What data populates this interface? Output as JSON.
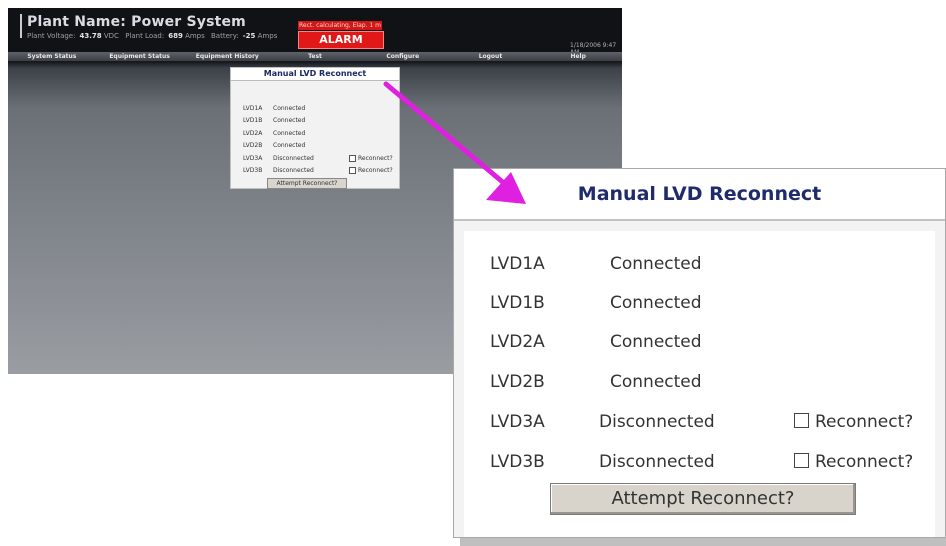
{
  "app": {
    "plant_label": "Plant Name:",
    "plant_name": "Power System",
    "stats": {
      "voltage_label": "Plant Voltage:",
      "voltage_value": "43.78",
      "voltage_unit": "VDC",
      "load_label": "Plant Load:",
      "load_value": "689",
      "load_unit": "Amps",
      "battery_label": "Battery:",
      "battery_value": "-25",
      "battery_unit": "Amps"
    },
    "rect_status": "Rect. calculating, Elap. 1 m",
    "alarm": "ALARM",
    "timestamp": "1/18/2006 9:47 AM",
    "menu": [
      "System Status",
      "Equipment Status",
      "Equipment History",
      "Test",
      "Configure",
      "Logout",
      "Help"
    ]
  },
  "dialog": {
    "title": "Manual LVD Reconnect",
    "rows": [
      {
        "name": "LVD1A",
        "status": "Connected"
      },
      {
        "name": "LVD1B",
        "status": "Connected"
      },
      {
        "name": "LVD2A",
        "status": "Connected"
      },
      {
        "name": "LVD2B",
        "status": "Connected"
      },
      {
        "name": "LVD3A",
        "status": "Disconnected",
        "checkbox_label": "Reconnect?"
      },
      {
        "name": "LVD3B",
        "status": "Disconnected",
        "checkbox_label": "Reconnect?"
      }
    ],
    "button_label": "Attempt Reconnect?"
  },
  "colors": {
    "arrow": "#e020e0",
    "alarm": "#e01818",
    "title_text": "#1f2b6b"
  }
}
